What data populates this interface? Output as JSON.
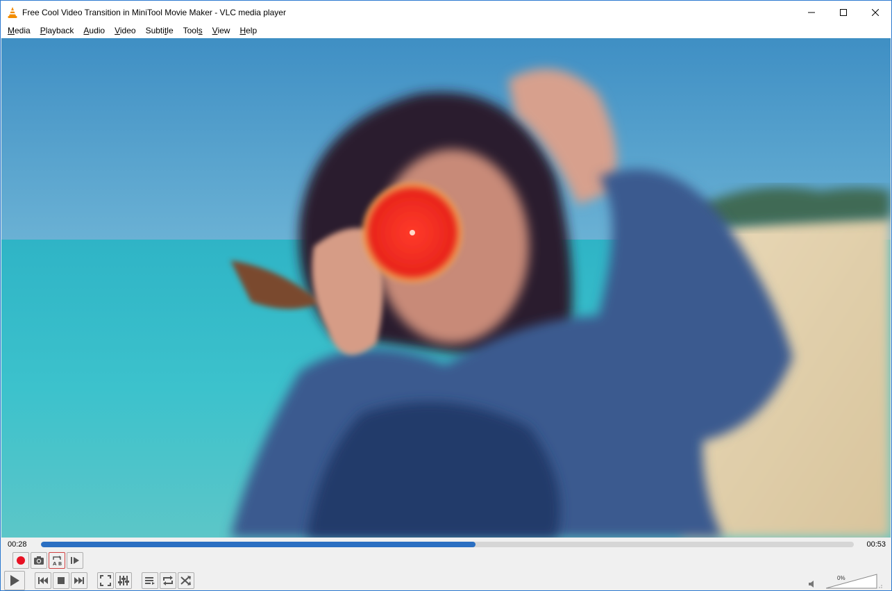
{
  "window": {
    "title": "Free Cool Video Transition in MiniTool Movie Maker - VLC media player",
    "app_icon": "vlc-cone-icon",
    "controls": [
      "minimize-icon",
      "maximize-icon",
      "close-icon"
    ]
  },
  "menu": {
    "items": [
      {
        "label": "Media",
        "ul": "M",
        "rest": "edia"
      },
      {
        "label": "Playback",
        "ul": "P",
        "rest": "layback"
      },
      {
        "label": "Audio",
        "ul": "A",
        "rest": "udio"
      },
      {
        "label": "Video",
        "ul": "V",
        "rest": "ideo"
      },
      {
        "label": "Subtitle",
        "pre": "Subti",
        "ul": "t",
        "rest": "le"
      },
      {
        "label": "Tools",
        "pre": "Tool",
        "ul": "s",
        "rest": ""
      },
      {
        "label": "View",
        "ul": "V",
        "rest": "iew"
      },
      {
        "label": "Help",
        "ul": "H",
        "rest": "elp"
      }
    ]
  },
  "playback": {
    "elapsed": "00:28",
    "total": "00:53",
    "progress_fraction": 0.535
  },
  "advanced_controls": [
    "record-icon",
    "snapshot-icon",
    "ab-loop-icon",
    "frame-step-icon"
  ],
  "main_controls": {
    "play": "play-icon",
    "transport": [
      "previous-icon",
      "stop-icon",
      "next-icon"
    ],
    "view": [
      "fullscreen-icon",
      "extended-settings-icon"
    ],
    "playlist": [
      "playlist-icon",
      "loop-icon",
      "shuffle-icon"
    ]
  },
  "volume": {
    "label": "0%",
    "level_fraction": 0.0
  },
  "colors": {
    "accent": "#2b6fc2",
    "record": "#e81123",
    "window_border": "#2b79d0"
  }
}
